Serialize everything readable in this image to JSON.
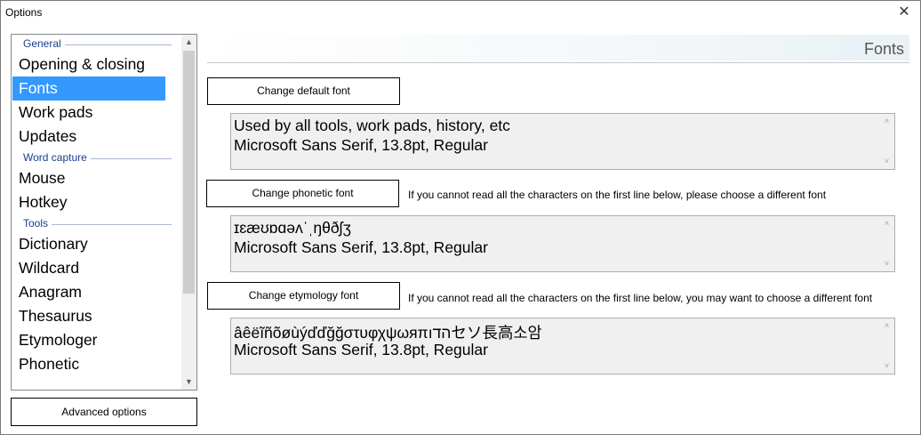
{
  "window": {
    "title": "Options",
    "close_glyph": "✕"
  },
  "nav": {
    "groups": [
      {
        "label": "General",
        "items": [
          "Opening & closing",
          "Fonts",
          "Work pads",
          "Updates"
        ]
      },
      {
        "label": "Word capture",
        "items": [
          "Mouse",
          "Hotkey"
        ]
      },
      {
        "label": "Tools",
        "items": [
          "Dictionary",
          "Wildcard",
          "Anagram",
          "Thesaurus",
          "Etymologer",
          "Phonetic"
        ]
      }
    ],
    "selected": "Fonts",
    "scroll_up_glyph": "▲",
    "scroll_down_glyph": "▼"
  },
  "advanced_button": "Advanced options",
  "panel": {
    "title": "Fonts",
    "default_font": {
      "button": "Change default font",
      "line1": "Used by all tools, work pads, history, etc",
      "line2": "Microsoft Sans Serif, 13.8pt, Regular"
    },
    "phonetic_font": {
      "button": "Change phonetic font",
      "hint": "If you cannot read all the characters on the first line below, please choose a different font",
      "line1": "ɪɛæʊɒɑəʌˈˌŋθðʃʒ",
      "line2": "Microsoft Sans Serif, 13.8pt, Regular"
    },
    "etymology_font": {
      "button": "Change etymology font",
      "hint": "If you cannot read all the characters on the first line below, you may want to choose a different font",
      "line1": "âêëĩñõøùýďďğğστυφχψωяπıהדセソ長高소암",
      "line2": "Microsoft Sans Serif, 13.8pt, Regular"
    },
    "box_scroll_up_glyph": "˄",
    "box_scroll_down_glyph": "˅"
  },
  "colors": {
    "selection": "#3399ff",
    "group_label": "#1a3e8c"
  }
}
